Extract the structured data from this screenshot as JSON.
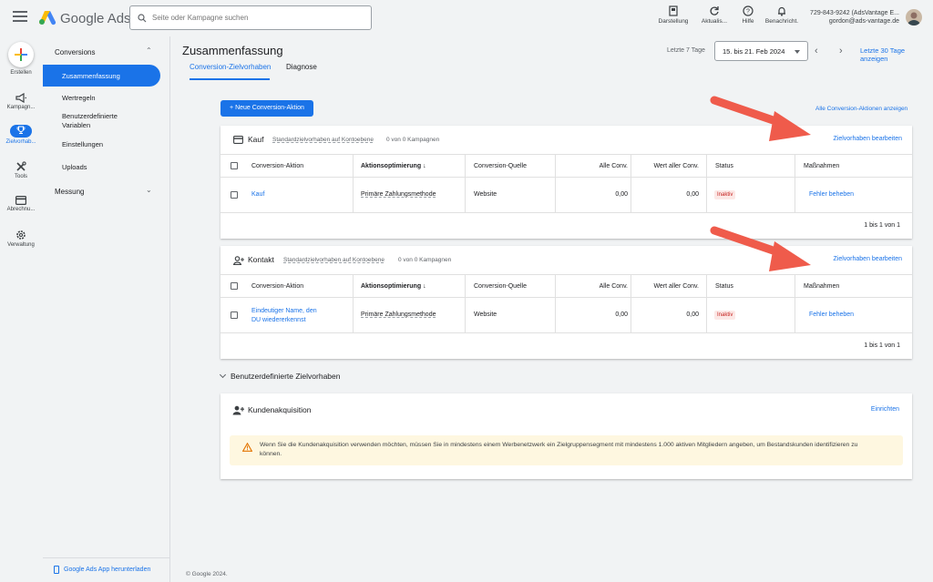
{
  "header": {
    "brand": "Google Ads",
    "search_placeholder": "Seite oder Kampagne suchen",
    "tools": [
      {
        "label": "Darstellung",
        "icon": "appearance-icon"
      },
      {
        "label": "Aktualis...",
        "icon": "refresh-icon"
      },
      {
        "label": "Hilfe",
        "icon": "help-icon"
      },
      {
        "label": "Benachricht.",
        "icon": "notification-bell-icon"
      }
    ],
    "account_line1": "729-843-9242 (AdsVantage E...",
    "account_line2": "gordon@ads-vantage.de"
  },
  "rail": {
    "create": "Erstellen",
    "items": [
      {
        "label": "Kampagn...",
        "icon": "megaphone-icon"
      },
      {
        "label": "Zielvorhab...",
        "icon": "trophy-icon",
        "active": true
      },
      {
        "label": "Tools",
        "icon": "tools-icon"
      },
      {
        "label": "Abrechnu...",
        "icon": "credit-card-icon"
      },
      {
        "label": "Verwaltung",
        "icon": "settings-icon"
      }
    ]
  },
  "subnav": {
    "section1": "Conversions",
    "active": "Zusammenfassung",
    "items": [
      "Wertregeln",
      "Benutzerdefinierte Variablen",
      "Einstellungen",
      "Uploads"
    ],
    "section2": "Messung",
    "app_download": "Google Ads App herunterladen"
  },
  "main": {
    "title": "Zusammenfassung",
    "tabs": [
      "Conversion-Zielvorhaben",
      "Diagnose"
    ],
    "date_label": "Letzte 7 Tage",
    "date_range": "15. bis 21. Feb 2024",
    "quick_range": "Letzte 30 Tage anzeigen",
    "new_action": "+ Neue Conversion-Aktion",
    "all_actions": "Alle Conversion-Aktionen anzeigen",
    "columns": [
      "Conversion-Aktion",
      "Aktionsoptimierung",
      "Conversion-Quelle",
      "Alle Conv.",
      "Wert aller Conv.",
      "Status",
      "Maßnahmen"
    ],
    "goals": [
      {
        "title": "Kauf",
        "sub": "Standardzielvorhaben auf Kontoebene",
        "campaigns": "0 von 0 Kampagnen",
        "edit": "Zielvorhaben bearbeiten",
        "row": {
          "action": "Kauf",
          "optimization": "Primäre Zahlungsmethode",
          "source": "Website",
          "conv": "0,00",
          "value": "0,00",
          "status": "Inaktiv",
          "fix": "Fehler beheben"
        },
        "pager": "1 bis 1 von 1"
      },
      {
        "title": "Kontakt",
        "sub": "Standardzielvorhaben auf Kontoebene",
        "campaigns": "0 von 0 Kampagnen",
        "edit": "Zielvorhaben bearbeiten",
        "row": {
          "action_line1": "Eindeutiger Name, den",
          "action_line2": "DU wiedererkennst",
          "optimization": "Primäre Zahlungsmethode",
          "source": "Website",
          "conv": "0,00",
          "value": "0,00",
          "status": "Inaktiv",
          "fix": "Fehler beheben"
        },
        "pager": "1 bis 1 von 1"
      }
    ],
    "custom_goals": "Benutzerdefinierte Zielvorhaben",
    "acquisition": {
      "title": "Kundenakquisition",
      "setup": "Einrichten",
      "notice": "Wenn Sie die Kundenakquisition verwenden möchten, müssen Sie in mindestens einem Werbenetzwerk ein Zielgruppensegment mit mindestens 1.000 aktiven Mitgliedern angeben, um Bestandskunden identifizieren zu können."
    },
    "footer": "© Google 2024."
  },
  "colors": {
    "accent": "#1a73e8",
    "arrow": "#ef5b4b",
    "inactive": "#c5221f"
  }
}
